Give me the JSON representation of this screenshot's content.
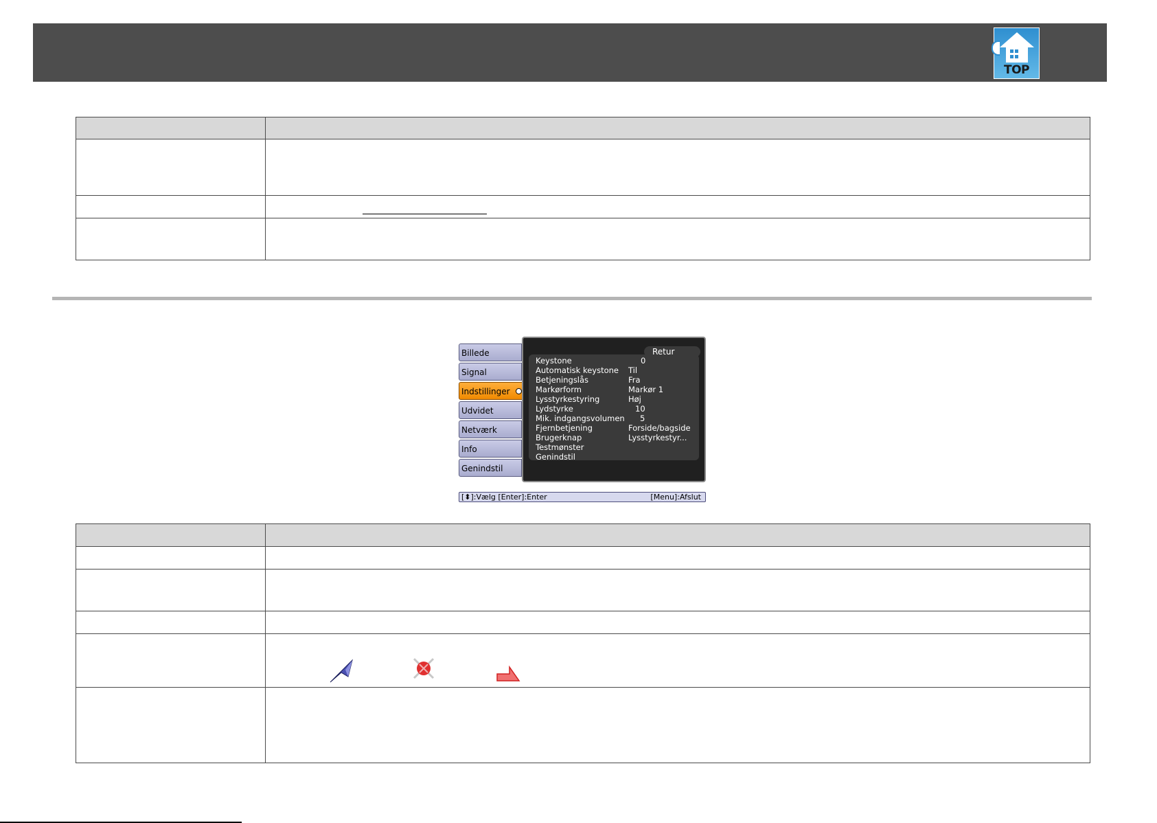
{
  "header": {
    "top_icon_label": "TOP",
    "top_icon_name": "top-home-icon",
    "accent_color": "#4d4d4d"
  },
  "osd_menu": {
    "tabs": [
      {
        "label": "Billede",
        "active": false
      },
      {
        "label": "Signal",
        "active": false
      },
      {
        "label": "Indstillinger",
        "active": true
      },
      {
        "label": "Udvidet",
        "active": false
      },
      {
        "label": "Netværk",
        "active": false
      },
      {
        "label": "Info",
        "active": false
      },
      {
        "label": "Genindstil",
        "active": false
      }
    ],
    "return_label": "Retur",
    "items": [
      {
        "label": "Keystone",
        "value": "0"
      },
      {
        "label": "Automatisk keystone",
        "value": "Til"
      },
      {
        "label": "Betjeningslås",
        "value": "Fra"
      },
      {
        "label": "Markørform",
        "value": "Markør 1"
      },
      {
        "label": "Lysstyrkestyring",
        "value": "Høj"
      },
      {
        "label": "Lydstyrke",
        "value": "10"
      },
      {
        "label": "Mik. indgangsvolumen",
        "value": "5"
      },
      {
        "label": "Fjernbetjening",
        "value": "Forside/bagside"
      },
      {
        "label": "Brugerknap",
        "value": "Lysstyrkestyr..."
      },
      {
        "label": "Testmønster",
        "value": ""
      },
      {
        "label": "Genindstil",
        "value": ""
      }
    ],
    "footer_left": "[⬍]:Vælg [Enter]:Enter",
    "footer_right": "[Menu]:Afslut",
    "active_color": "#f08a00",
    "tab_color": "#b9bbdc"
  },
  "pointer_shapes": {
    "shape1_icon": "pointer-arrow-icon",
    "shape2_icon": "pointer-crosshair-icon",
    "shape3_icon": "pointer-marker-icon"
  }
}
